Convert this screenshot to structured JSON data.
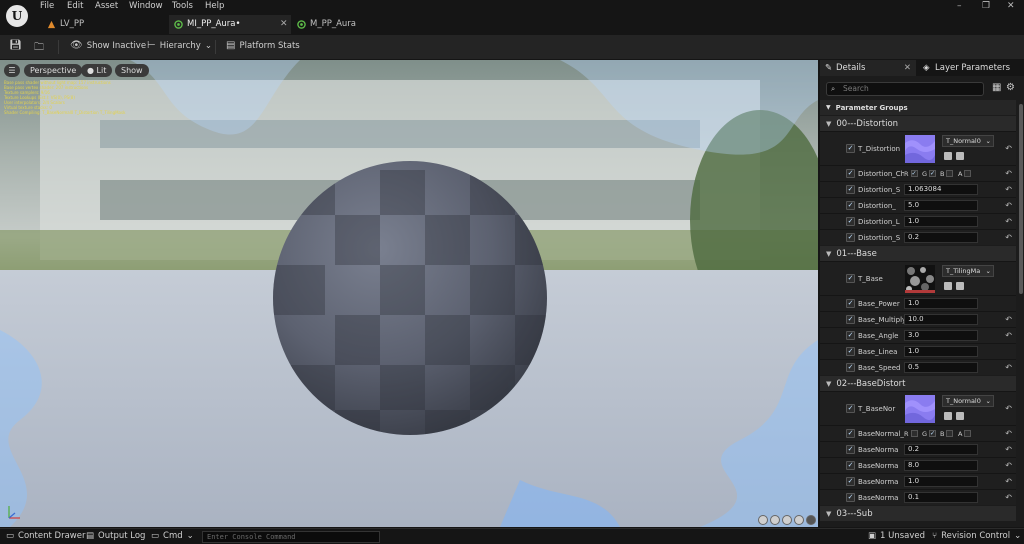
{
  "menu": [
    "File",
    "Edit",
    "Asset",
    "Window",
    "Tools",
    "Help"
  ],
  "logo_letter": "U",
  "window_controls": [
    "–",
    "❐",
    "✕"
  ],
  "tabs": [
    {
      "label": "LV_PP",
      "color": "#e08a2c"
    },
    {
      "label": "MI_PP_Aura•",
      "color": "#5fbf4a"
    },
    {
      "label": "M_PP_Aura",
      "color": "#5fbf4a"
    }
  ],
  "toolbar": {
    "show_inactive": "Show Inactive",
    "hierarchy": "Hierarchy",
    "platform_stats": "Platform Stats"
  },
  "viewport": {
    "perspective": "Perspective",
    "lit": "Lit",
    "show": "Show",
    "stats": [
      "Base pass shader without light map: 157 instructions",
      "Base pass vertex shader: 207 instructions",
      "Texture samplers: 9/16",
      "Texture Lookups (Est.): VS(0), PS(8)",
      "User interpolators: 2/4 Scalars",
      "Virtual texture stacks: 0",
      "Shader Compiling: T_BaseNormal0 T_Distortion T_TilingMask"
    ]
  },
  "details": {
    "tab_details": "Details",
    "tab_layer": "Layer Parameters",
    "search_placeholder": "Search",
    "param_groups": "Parameter Groups",
    "groups": [
      {
        "name": "00---Distortion",
        "texture": {
          "label": "T_Distortion",
          "asset": "T_Normal0",
          "thumb": "normal"
        },
        "channels_label": "Distortion_Ch",
        "channels": [
          "R",
          "G",
          "B",
          "A"
        ],
        "params": [
          {
            "label": "Distortion_S",
            "value": "1.063084"
          },
          {
            "label": "Distortion_",
            "value": "5.0"
          },
          {
            "label": "Distortion_L",
            "value": "1.0"
          },
          {
            "label": "Distortion_S",
            "value": "0.2"
          }
        ]
      },
      {
        "name": "01---Base",
        "texture": {
          "label": "T_Base",
          "asset": "T_TilingMa",
          "thumb": "noise"
        },
        "params": [
          {
            "label": "Base_Power",
            "value": "1.0"
          },
          {
            "label": "Base_Multiply",
            "value": "10.0"
          },
          {
            "label": "Base_Angle",
            "value": "3.0"
          },
          {
            "label": "Base_Linea",
            "value": "1.0"
          },
          {
            "label": "Base_Speed",
            "value": "0.5"
          }
        ]
      },
      {
        "name": "02---BaseDistort",
        "texture": {
          "label": "T_BaseNor",
          "asset": "T_Normal0",
          "thumb": "normal"
        },
        "channels_label": "BaseNormal_I",
        "channels": [
          "R",
          "G",
          "B",
          "A"
        ],
        "params": [
          {
            "label": "BaseNorma",
            "value": "0.2"
          },
          {
            "label": "BaseNorma",
            "value": "8.0"
          },
          {
            "label": "BaseNorma",
            "value": "1.0"
          },
          {
            "label": "BaseNorma",
            "value": "0.1"
          }
        ]
      },
      {
        "name": "03---Sub"
      }
    ]
  },
  "status": {
    "content_drawer": "Content Drawer",
    "output_log": "Output Log",
    "cmd": "Cmd",
    "console_placeholder": "Enter Console Command",
    "unsaved": "1 Unsaved",
    "revision": "Revision Control"
  }
}
